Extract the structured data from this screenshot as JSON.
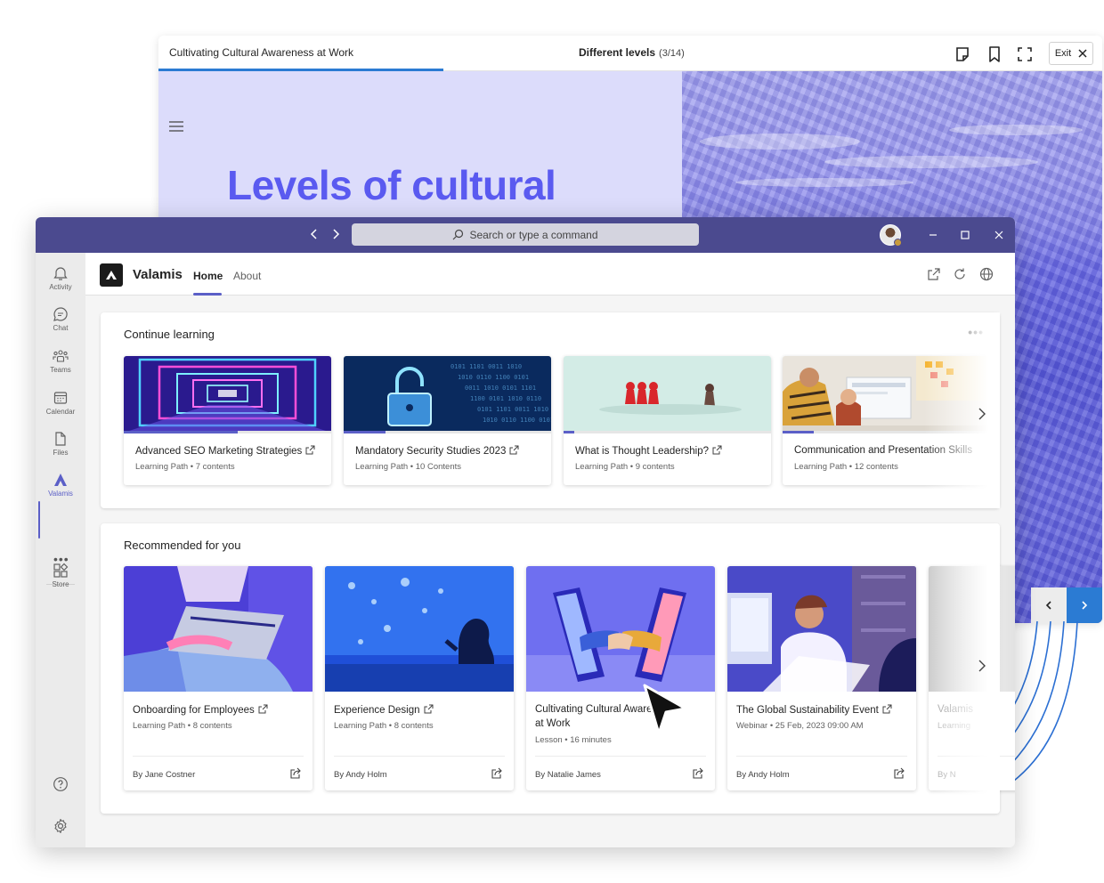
{
  "viewer": {
    "course_title": "Cultivating Cultural Awareness at Work",
    "slide_title": "Different levels",
    "slide_count": "(3/14)",
    "exit_label": "Exit",
    "progress": 0.3,
    "heading": "Levels of cultural awareness",
    "icons": [
      "note-icon",
      "bookmark-icon",
      "fullscreen-icon",
      "close-icon",
      "menu-icon",
      "chevron-left-icon",
      "chevron-right-icon"
    ]
  },
  "teams": {
    "search_placeholder": "Search or type a command",
    "rail": [
      {
        "label": "Activity",
        "icon": "bell-icon"
      },
      {
        "label": "Chat",
        "icon": "chat-icon"
      },
      {
        "label": "Teams",
        "icon": "teams-icon"
      },
      {
        "label": "Calendar",
        "icon": "calendar-icon"
      },
      {
        "label": "Files",
        "icon": "file-icon"
      },
      {
        "label": "Valamis",
        "icon": "valamis-icon",
        "active": true
      },
      {
        "label": "Store",
        "icon": "store-icon"
      }
    ],
    "rail_more": "•••"
  },
  "app": {
    "name": "Valamis",
    "tabs": [
      {
        "label": "Home",
        "active": true
      },
      {
        "label": "About"
      }
    ],
    "accent": "#5b5fc7"
  },
  "continue_learning": {
    "title": "Continue learning",
    "cards": [
      {
        "title": "Advanced SEO Marketing Strategies",
        "meta": "Learning Path • 7 contents",
        "progress": 0.55
      },
      {
        "title": "Mandatory Security Studies 2023",
        "meta": "Learning Path • 10 Contents",
        "progress": 0.2
      },
      {
        "title": "What is Thought Leadership?",
        "meta": "Learning Path • 9 contents",
        "progress": 0.05
      },
      {
        "title": "Communication and Presentation Skills",
        "meta": "Learning Path • 12 contents",
        "progress": 0.15
      }
    ]
  },
  "recommended": {
    "title": "Recommended for you",
    "cards": [
      {
        "title": "Onboarding for Employees",
        "meta": "Learning Path • 8 contents",
        "author": "By Jane Costner"
      },
      {
        "title": "Experience Design",
        "meta": "Learning Path • 8 contents",
        "author": "By Andy Holm"
      },
      {
        "title": "Cultivating Cultural Awareness",
        "title2": "at Work",
        "meta": "Lesson • 16 minutes",
        "author": "By Natalie James"
      },
      {
        "title": "The Global Sustainability Event",
        "meta": "Webinar • 25 Feb, 2023 09:00 AM",
        "author": "By Andy Holm"
      },
      {
        "title": "Valamis",
        "meta": "Learning",
        "author": "By N"
      }
    ]
  }
}
